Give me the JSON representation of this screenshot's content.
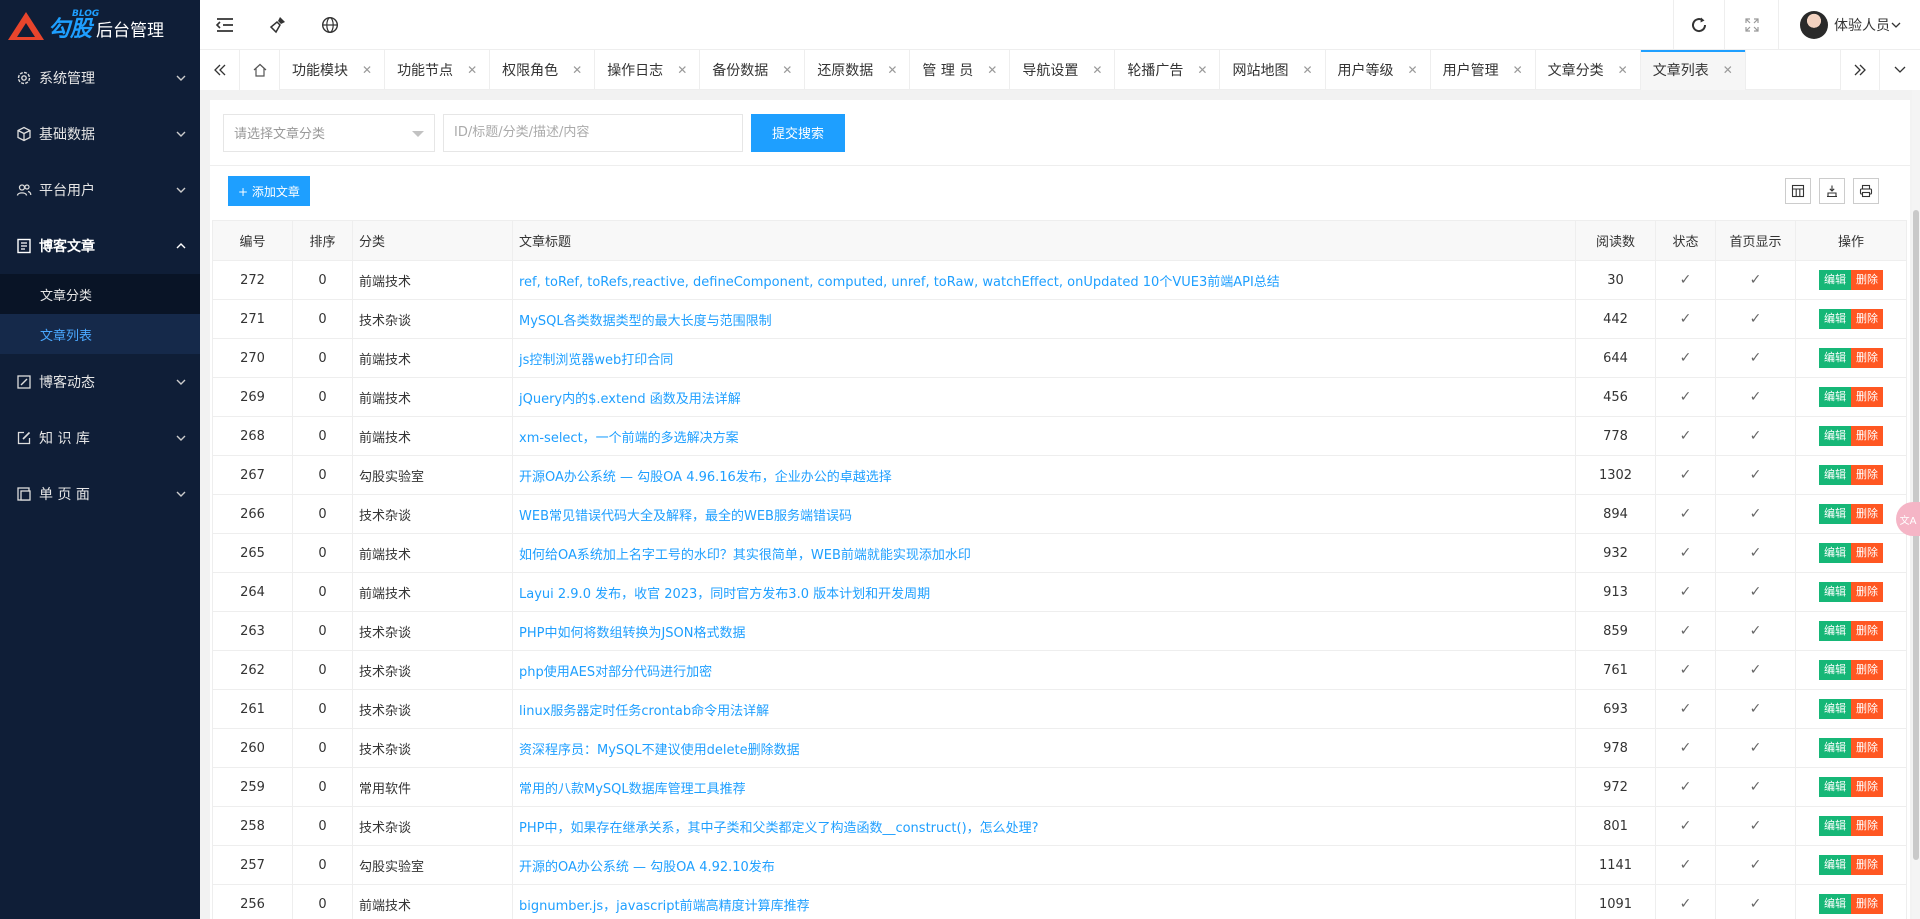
{
  "logo": {
    "blog": "BLOG",
    "brand": "勾股",
    "subtitle": "后台管理"
  },
  "sidebar": {
    "items": [
      {
        "label": "系统管理",
        "icon": "gear-icon",
        "expanded": false
      },
      {
        "label": "基础数据",
        "icon": "cube-icon",
        "expanded": false
      },
      {
        "label": "平台用户",
        "icon": "users-icon",
        "expanded": false
      },
      {
        "label": "博客文章",
        "icon": "article-icon",
        "expanded": true,
        "children": [
          {
            "label": "文章分类"
          },
          {
            "label": "文章列表",
            "selected": true
          }
        ]
      },
      {
        "label": "博客动态",
        "icon": "edit-icon",
        "expanded": false
      },
      {
        "label": "知 识 库",
        "icon": "pencil-icon",
        "expanded": false
      },
      {
        "label": "单 页 面",
        "icon": "page-icon",
        "expanded": false
      }
    ]
  },
  "topbar": {
    "user_name": "体验人员"
  },
  "tabs": [
    {
      "label": "功能模块"
    },
    {
      "label": "功能节点"
    },
    {
      "label": "权限角色"
    },
    {
      "label": "操作日志"
    },
    {
      "label": "备份数据"
    },
    {
      "label": "还原数据"
    },
    {
      "label": "管 理 员"
    },
    {
      "label": "导航设置"
    },
    {
      "label": "轮播广告"
    },
    {
      "label": "网站地图"
    },
    {
      "label": "用户等级"
    },
    {
      "label": "用户管理"
    },
    {
      "label": "文章分类"
    },
    {
      "label": "文章列表",
      "active": true
    }
  ],
  "search": {
    "category_placeholder": "请选择文章分类",
    "keyword_placeholder": "ID/标题/分类/描述/内容",
    "submit_label": "提交搜索"
  },
  "toolbar": {
    "add_label": "+ 添加文章"
  },
  "table": {
    "headers": [
      "编号",
      "排序",
      "分类",
      "文章标题",
      "阅读数",
      "状态",
      "首页显示",
      "操作"
    ],
    "edit_label": "编辑",
    "delete_label": "删除",
    "check_mark": "✓",
    "rows": [
      {
        "id": "272",
        "sort": "0",
        "category": "前端技术",
        "title": "ref, toRef, toRefs,reactive, defineComponent, computed, unref, toRaw, watchEffect, onUpdated 10个VUE3前端API总结",
        "reads": "30"
      },
      {
        "id": "271",
        "sort": "0",
        "category": "技术杂谈",
        "title": "MySQL各类数据类型的最大长度与范围限制",
        "reads": "442"
      },
      {
        "id": "270",
        "sort": "0",
        "category": "前端技术",
        "title": "js控制浏览器web打印合同",
        "reads": "644"
      },
      {
        "id": "269",
        "sort": "0",
        "category": "前端技术",
        "title": "jQuery内的$.extend 函数及用法详解",
        "reads": "456"
      },
      {
        "id": "268",
        "sort": "0",
        "category": "前端技术",
        "title": "xm-select，一个前端的多选解决方案",
        "reads": "778"
      },
      {
        "id": "267",
        "sort": "0",
        "category": "勾股实验室",
        "title": "开源OA办公系统 — 勾股OA 4.96.16发布，企业办公的卓越选择",
        "reads": "1302"
      },
      {
        "id": "266",
        "sort": "0",
        "category": "技术杂谈",
        "title": "WEB常见错误代码大全及解释，最全的WEB服务端错误码",
        "reads": "894"
      },
      {
        "id": "265",
        "sort": "0",
        "category": "前端技术",
        "title": "如何给OA系统加上名字工号的水印？其实很简单，WEB前端就能实现添加水印",
        "reads": "932"
      },
      {
        "id": "264",
        "sort": "0",
        "category": "前端技术",
        "title": "Layui 2.9.0 发布，收官 2023，同时官方发布3.0 版本计划和开发周期",
        "reads": "913"
      },
      {
        "id": "263",
        "sort": "0",
        "category": "技术杂谈",
        "title": "PHP中如何将数组转换为JSON格式数据",
        "reads": "859"
      },
      {
        "id": "262",
        "sort": "0",
        "category": "技术杂谈",
        "title": "php使用AES对部分代码进行加密",
        "reads": "761"
      },
      {
        "id": "261",
        "sort": "0",
        "category": "技术杂谈",
        "title": "linux服务器定时任务crontab命令用法详解",
        "reads": "693"
      },
      {
        "id": "260",
        "sort": "0",
        "category": "技术杂谈",
        "title": "资深程序员：MySQL不建议使用delete删除数据",
        "reads": "978"
      },
      {
        "id": "259",
        "sort": "0",
        "category": "常用软件",
        "title": "常用的八款MySQL数据库管理工具推荐",
        "reads": "972"
      },
      {
        "id": "258",
        "sort": "0",
        "category": "技术杂谈",
        "title": "PHP中，如果存在继承关系，其中子类和父类都定义了构造函数__construct()，怎么处理?",
        "reads": "801"
      },
      {
        "id": "257",
        "sort": "0",
        "category": "勾股实验室",
        "title": "开源的OA办公系统 — 勾股OA 4.92.10发布",
        "reads": "1141"
      },
      {
        "id": "256",
        "sort": "0",
        "category": "前端技术",
        "title": "bignumber.js，javascript前端高精度计算库推荐",
        "reads": "1091"
      }
    ]
  },
  "colors": {
    "sidebar_bg": "#0f1e37",
    "accent": "#1e9fff",
    "edit": "#16b777",
    "delete": "#ff5722"
  }
}
